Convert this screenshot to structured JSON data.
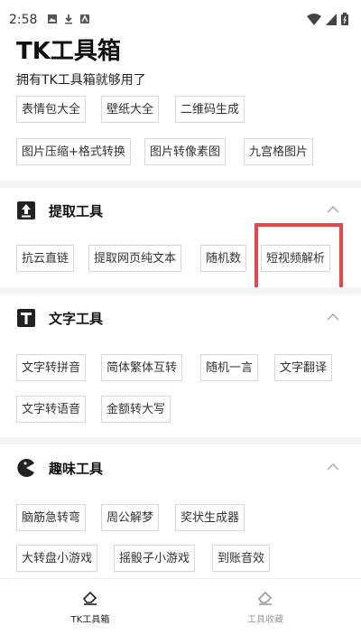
{
  "status_bar": {
    "time": "2:58"
  },
  "header": {
    "title": "TK工具箱",
    "subtitle": "拥有TK工具箱就够用了"
  },
  "top_tools": [
    "表情包大全",
    "壁纸大全",
    "二维码生成",
    "图片压缩+格式转换",
    "图片转像素图",
    "九宫格图片"
  ],
  "sections": [
    {
      "title": "提取工具",
      "icon": "upload-icon",
      "items": [
        "抗云直链",
        "提取网页纯文本",
        "随机数",
        "短视频解析"
      ]
    },
    {
      "title": "文字工具",
      "icon": "text-icon",
      "items": [
        "文字转拼音",
        "简体繁体互转",
        "随机一言",
        "文字翻译",
        "文字转语音",
        "金额转大写"
      ]
    },
    {
      "title": "趣味工具",
      "icon": "pacman-icon",
      "items": [
        "脑筋急转弯",
        "周公解梦",
        "奖状生成器",
        "大转盘小游戏",
        "摇骰子小游戏",
        "到账音效"
      ]
    }
  ],
  "tabs": [
    {
      "label": "TK工具箱",
      "icon": "eraser-icon",
      "active": true
    },
    {
      "label": "工具收藏",
      "icon": "eraser-icon",
      "active": false
    }
  ],
  "colors": {
    "highlight": "#e8474a",
    "active_tab": "#222222",
    "inactive_tab": "#999999"
  }
}
